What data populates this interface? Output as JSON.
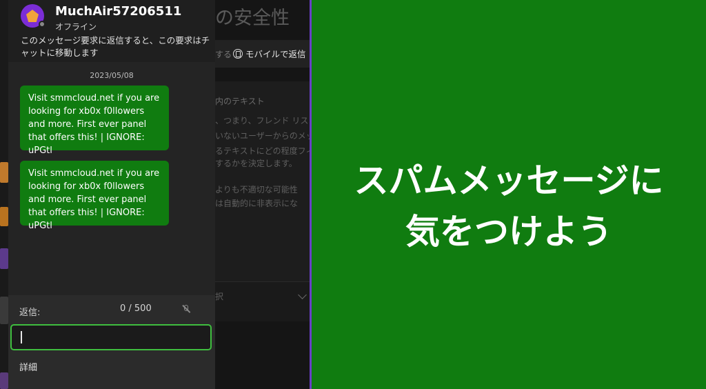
{
  "background_settings": {
    "title": "の安全性",
    "mobile_reply": "モバイルで返信",
    "band_text": "する",
    "section_heading": "内のテキスト",
    "description_lines": [
      "、つまり、フレンド リスト",
      "いないユーザーからのメッ",
      "るテキストにどの程度フィ",
      "するかを決定します。",
      "",
      "よりも不適切な可能性",
      "は自動的に非表示にな"
    ],
    "select_label": "択"
  },
  "chat": {
    "gamertag": "MuchAir57206511",
    "status": "オフライン",
    "notice": "このメッセージ要求に返信すると、この要求はチャットに移動します",
    "date": "2023/05/08",
    "messages": [
      {
        "text": "Visit smmcloud.net if you are looking for xb0x f0llowers and more. First ever panel that offers this! | IGNORE: uPGtl"
      },
      {
        "text": "Visit smmcloud.net if you are looking for xb0x f0llowers and more. First ever panel that offers this! | IGNORE: uPGtl"
      }
    ],
    "reply_label": "返信:",
    "counter": "0 / 500",
    "input_value": "",
    "details": "詳細"
  },
  "banner": {
    "line1": "スパムメッセージに",
    "line2": "気をつけよう"
  },
  "colors": {
    "xbox_green": "#107c10",
    "input_border": "#3fbf3f",
    "avatar_bg": "#7b2dd6",
    "avatar_shape": "#f1a33a",
    "divider": "#6a3fc8"
  },
  "icons": {
    "presence": "presence-dot-icon",
    "mobile": "mobile-reply-icon",
    "mute": "mic-off-icon",
    "select": "chevron-down-icon"
  }
}
